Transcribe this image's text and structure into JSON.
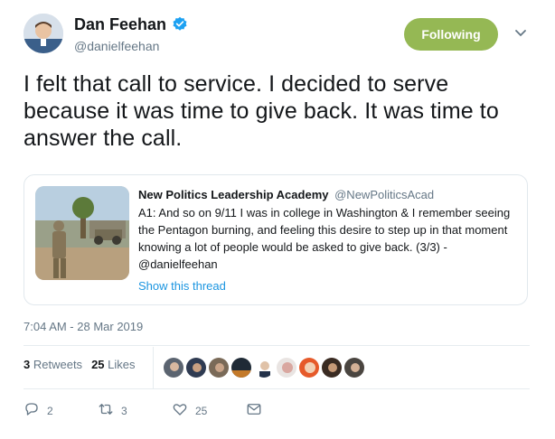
{
  "author": {
    "display_name": "Dan Feehan",
    "handle": "@danielfeehan",
    "verified": true
  },
  "follow_button_label": "Following",
  "tweet_text": "I felt that call to service. I decided to serve because it was time to give back. It was time to answer the call.",
  "quoted_tweet": {
    "display_name": "New Politics Leadership Academy",
    "handle": "@NewPoliticsAcad",
    "text": "A1: And so on 9/11 I was in college in Washington & I remember seeing the Pentagon burning, and feeling this desire to step up in that moment knowing a lot of people would be asked to give back. (3/3) -@danielfeehan",
    "show_thread_label": "Show this thread"
  },
  "timestamp": "7:04 AM - 28 Mar 2019",
  "stats": {
    "retweets_count": "3",
    "retweets_label": "Retweets",
    "likes_count": "25",
    "likes_label": "Likes"
  },
  "liker_avatars_count": 9,
  "actions": {
    "reply_count": "2",
    "retweet_count": "3",
    "like_count": "25"
  },
  "colors": {
    "following_button": "#95b854",
    "verified_badge": "#1da1f2",
    "link": "#1b95e0",
    "secondary_text": "#657786"
  }
}
